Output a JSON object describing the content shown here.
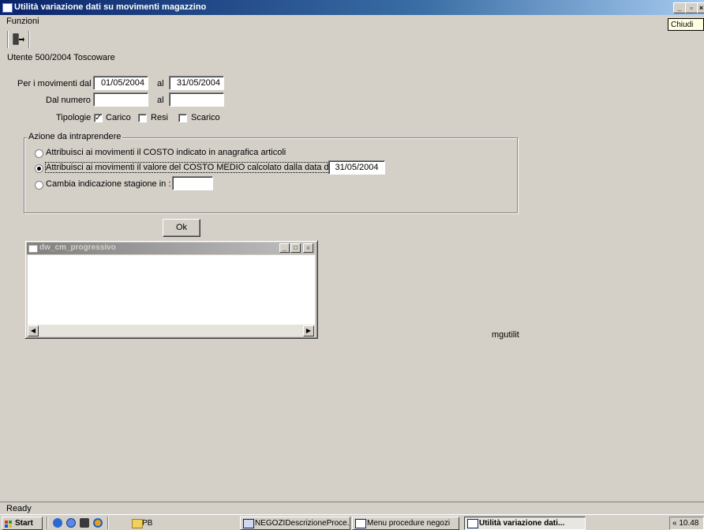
{
  "window": {
    "title": "Utilità variazione dati su movimenti magazzino"
  },
  "menu": {
    "funzioni": "Funzioni"
  },
  "tooltip": "Chiudi",
  "user_line": "Utente 500/2004 Toscoware",
  "form": {
    "date_label": "Per i movimenti dal",
    "date_from": "01/05/2004",
    "al_label": "al",
    "date_to": "31/05/2004",
    "num_label": "Dal numero",
    "num_from": "",
    "num_al_label": "al",
    "num_to": "",
    "tipologie_label": "Tipologie",
    "types": [
      {
        "label": "Carico",
        "checked": true
      },
      {
        "label": "Resi",
        "checked": false
      },
      {
        "label": "Scarico",
        "checked": false
      }
    ]
  },
  "azione": {
    "title": "Azione da intraprendere",
    "option1": "Attribuisci ai movimenti il COSTO indicato in anagrafica articoli",
    "option2": "Attribuisci ai movimenti il valore del COSTO MEDIO calcolato dalla data del",
    "option2_date": "31/05/2004",
    "option3": "Cambia indicazione stagione in :",
    "option3_value": "",
    "selected": 2
  },
  "ok_label": "Ok",
  "child_window": {
    "title": "dw_cm_progressivo"
  },
  "side_label": "mgutilit",
  "status": "Ready",
  "taskbar": {
    "start": "Start",
    "items": [
      "PB",
      "NEGOZIDescrizioneProce...",
      "Menu procedure negozi",
      "Utilità variazione dati..."
    ],
    "clock": "« 10.48"
  }
}
